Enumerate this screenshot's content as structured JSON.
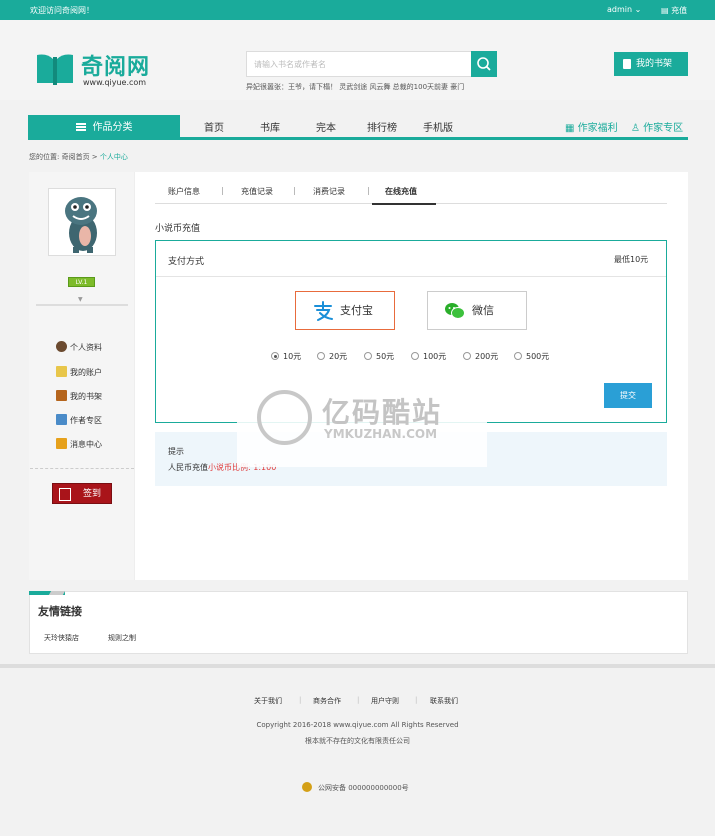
{
  "topbar": {
    "welcome": "欢迎访问奇阅网！",
    "user": "admin",
    "recharge": "充值"
  },
  "logo": {
    "name": "奇阅网",
    "url": "www.qiyue.com"
  },
  "search": {
    "placeholder": "请输入书名或作者名",
    "hotwords": "异妃很嚣张：王爷，请下榻！ 灵武剑途 风云舞 总裁的100天前妻 豪门"
  },
  "header": {
    "shelf_label": "我的书架"
  },
  "nav": {
    "category": "作品分类",
    "items": [
      "首页",
      "书库",
      "完本",
      "排行榜",
      "手机版"
    ],
    "author_welfare": "作家福利",
    "author_zone": "作家专区"
  },
  "breadcrumb": {
    "prefix": "您的位置: 奇阅首页 >",
    "current": "个人中心"
  },
  "sidebar": {
    "badge": "LV.1",
    "items": [
      "个人资料",
      "我的账户",
      "我的书架",
      "作者专区",
      "消息中心"
    ],
    "signin": "签到"
  },
  "tabs": [
    "账户信息",
    "充值记录",
    "消费记录",
    "在线充值"
  ],
  "recharge": {
    "section_title": "小说币充值",
    "pay_label": "支付方式",
    "min_label": "最低10元",
    "methods": [
      "支付宝",
      "微信"
    ],
    "amounts": [
      "10元",
      "20元",
      "50元",
      "100元",
      "200元",
      "500元"
    ],
    "selected_amount": "10元",
    "submit": "提交"
  },
  "tip": {
    "title": "提示",
    "text_prefix": "人民币充值",
    "text_red": "小说币比例: 1:100"
  },
  "watermark": {
    "cn": "亿码酷站",
    "en": "YMKUZHAN.COM"
  },
  "links": {
    "title": "友情链接",
    "items": [
      "天玲侠猿店",
      "规则之制"
    ]
  },
  "footer": {
    "links": [
      "关于我们",
      "商务合作",
      "用户守则",
      "联系我们"
    ],
    "copyright": "Copyright 2016-2018 www.qiyue.com All Rights Reserved",
    "company": "根本就不存在的文化有限责任公司",
    "police": "公网安备 000000000000号"
  },
  "colors": {
    "brand": "#1aab9b",
    "submit": "#2a9fd6",
    "signin": "#a9141a",
    "alipay_border": "#e86b3c"
  }
}
